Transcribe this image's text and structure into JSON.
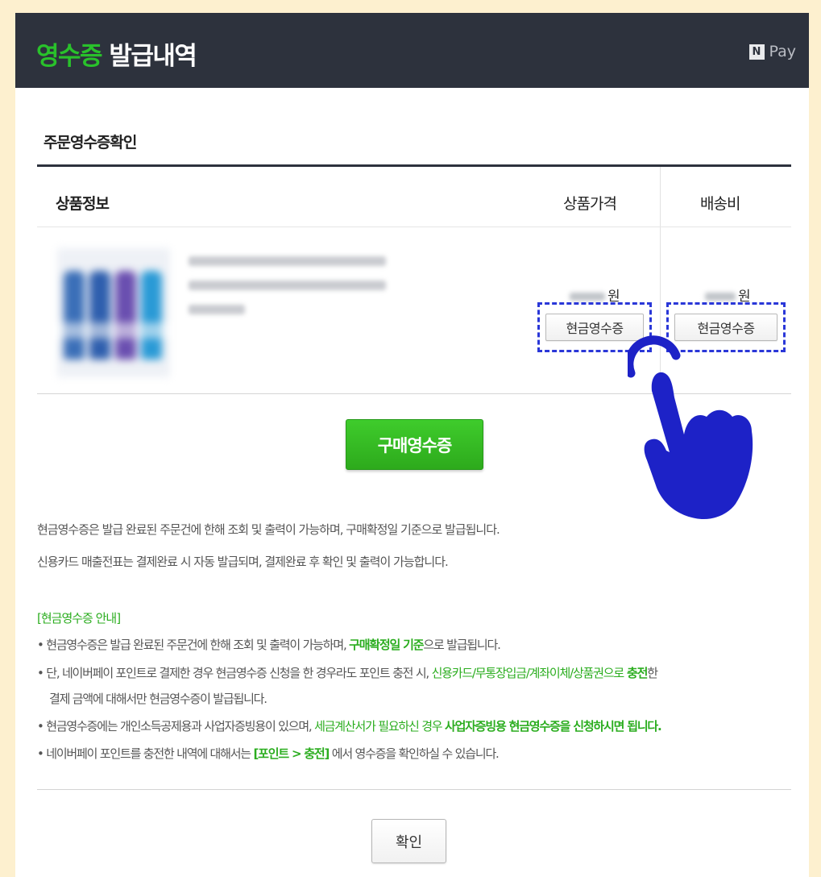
{
  "header": {
    "title_accent": "영수증",
    "title_rest": " 발급내역",
    "brand_badge": "N",
    "brand_label": "Pay"
  },
  "section_title": "주문영수증확인",
  "table": {
    "col_product": "상품정보",
    "col_price": "상품가격",
    "col_shipping": "배송비",
    "row": {
      "price_unit": "원",
      "shipping_unit": "원",
      "price_button": "현금영수증",
      "shipping_button": "현금영수증"
    }
  },
  "purchase_receipt_button": "구매영수증",
  "notes": [
    "현금영수증은 발급 완료된 주문건에 한해 조회 및 출력이 가능하며, 구매확정일 기준으로 발급됩니다.",
    "신용카드 매출전표는 결제완료 시 자동 발급되며, 결제완료 후 확인 및 출력이 가능합니다."
  ],
  "guide": {
    "title": "[현금영수증 안내]",
    "b1_pre": "• 현금영수증은 발급 완료된 주문건에 한해 조회 및 출력이 가능하며, ",
    "b1_hl": "구매확정일 기준",
    "b1_post": "으로 발급됩니다.",
    "b2_pre": "• 단, 네이버페이 포인트로 결제한 경우 현금영수증 신청을 한 경우라도 포인트 충전 시, ",
    "b2_hl1": "신용카드/무통장입금/계좌이체/상품권으로",
    "b2_hl2": " 충전",
    "b2_post": "한",
    "b2_line2": "결제 금액에 대해서만 현금영수증이 발급됩니다.",
    "b3_pre": "• 현금영수증에는 개인소득공제용과 사업자증빙용이 있으며, ",
    "b3_hl1": "세금계산서가 필요하신 경우 ",
    "b3_hl2": "사업자증빙용 현금영수증을 신청하시면 됩니다.",
    "b4_pre": "• 네이버페이 포인트를 충전한 내역에 대해서는 ",
    "b4_hl": "[포인트 > 충전]",
    "b4_post": " 에서 영수증을 확인하실 수 있습니다."
  },
  "confirm_button": "확인",
  "colors": {
    "header_bg": "#2d323d",
    "accent_green": "#29c12b",
    "highlight_blue": "#2a37d8",
    "page_bg": "#fdf0cf"
  },
  "icons": {
    "pointer": "tap-hand-icon",
    "brand": "naver-pay-logo"
  }
}
